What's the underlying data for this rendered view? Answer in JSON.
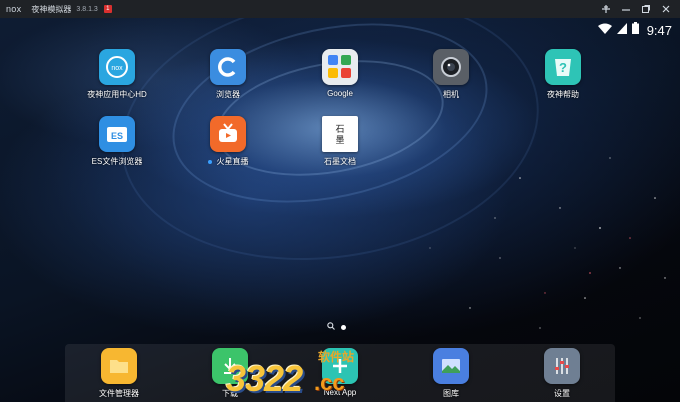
{
  "titlebar": {
    "logo": "nox",
    "title": "夜神模拟器",
    "version": "3.8.1.3",
    "badge": "1",
    "controls": [
      "pin-icon",
      "minimize-icon",
      "restore-icon",
      "close-icon"
    ]
  },
  "statusbar": {
    "time": "9:47",
    "icons": [
      "wifi-icon",
      "signal-icon",
      "battery-icon"
    ]
  },
  "desktop": {
    "apps": [
      {
        "label": "夜神应用中心HD",
        "icon": "nox-app-center-icon",
        "color": "#2aa6e0"
      },
      {
        "label": "浏览器",
        "icon": "browser-icon",
        "color": "#3b8de0"
      },
      {
        "label": "Google",
        "icon": "google-folder-icon",
        "color": "#e8ecef"
      },
      {
        "label": "相机",
        "icon": "camera-icon",
        "color": "#5a5f66"
      },
      {
        "label": "夜神帮助",
        "icon": "nox-help-icon",
        "color": "#2ec4b6"
      },
      {
        "label": "ES文件浏览器",
        "icon": "es-file-explorer-icon",
        "color": "#2f8fe3"
      },
      {
        "label": "火星直播",
        "icon": "huoxing-live-icon",
        "color": "#f26a2a"
      },
      {
        "label": "石墨文档",
        "icon": "shimo-docs-icon",
        "color": "#ffffff",
        "glyph": "石\n墨"
      }
    ],
    "pager": {
      "search_glyph": "🔍"
    }
  },
  "dock": {
    "apps": [
      {
        "label": "文件管理器",
        "icon": "file-manager-icon",
        "color": "#f7b731"
      },
      {
        "label": "下载",
        "icon": "download-icon",
        "color": "#3cc46a"
      },
      {
        "label": "Next App",
        "icon": "next-app-icon",
        "color": "#2cc4b3"
      },
      {
        "label": "图库",
        "icon": "gallery-icon",
        "color": "#4a7fe0"
      },
      {
        "label": "设置",
        "icon": "settings-icon",
        "color": "#6f7f93"
      }
    ]
  },
  "watermark": {
    "number": "3322",
    "suffix": ".cc",
    "site": "软件站"
  }
}
